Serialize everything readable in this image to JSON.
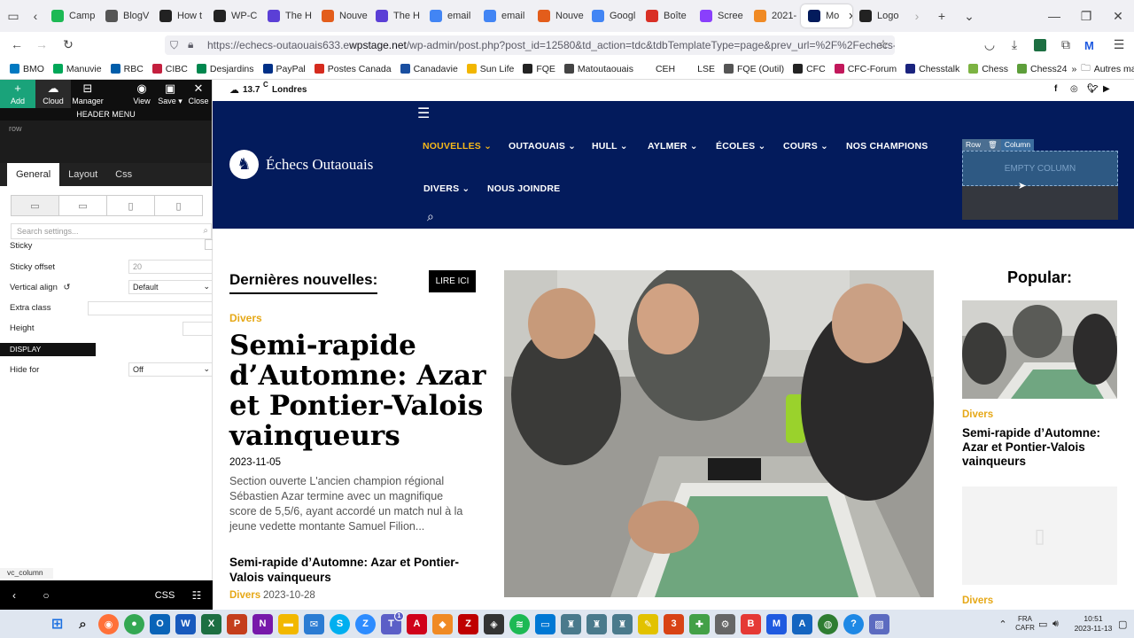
{
  "browser": {
    "tabs": [
      {
        "label": "Camp",
        "color": "#1db954"
      },
      {
        "label": "BlogV",
        "color": "#555"
      },
      {
        "label": "How t",
        "color": "#222"
      },
      {
        "label": "WP-C",
        "color": "#222"
      },
      {
        "label": "The H",
        "color": "#5b3fd6"
      },
      {
        "label": "Nouve",
        "color": "#e35d1b"
      },
      {
        "label": "The H",
        "color": "#5b3fd6"
      },
      {
        "label": "email",
        "color": "#4285f4"
      },
      {
        "label": "email",
        "color": "#4285f4"
      },
      {
        "label": "Nouve",
        "color": "#e35d1b"
      },
      {
        "label": "Googl",
        "color": "#4285f4"
      },
      {
        "label": "Boîte",
        "color": "#d93025"
      },
      {
        "label": "Scree",
        "color": "#8a3ffc"
      },
      {
        "label": "2021-",
        "color": "#f08a24"
      },
      {
        "label": "Mo",
        "color": "#031b5c"
      },
      {
        "label": "Logo",
        "color": "#222"
      }
    ],
    "url_prefix": "https://echecs-outaouais633.e",
    "url_domain": "wpstage.net",
    "url_rest": "/wp-admin/post.php?post_id=12580&td_action=tdc&tdbTemplateType=page&prev_url=%2F%2Fechecs-outaouais",
    "bookmarks": [
      {
        "label": "BMO",
        "color": "#0079c1"
      },
      {
        "label": "Manuvie",
        "color": "#00a758"
      },
      {
        "label": "RBC",
        "color": "#005daa"
      },
      {
        "label": "CIBC",
        "color": "#c41f3e"
      },
      {
        "label": "Desjardins",
        "color": "#00874e"
      },
      {
        "label": "PayPal",
        "color": "#003087"
      },
      {
        "label": "Postes Canada",
        "color": "#d52b1e"
      },
      {
        "label": "Canadavie",
        "color": "#1a4fa0"
      },
      {
        "label": "Sun Life",
        "color": "#f2b600"
      },
      {
        "label": "FQE",
        "color": "#222"
      },
      {
        "label": "Matoutaouais",
        "color": "#444"
      },
      {
        "label": "CEH",
        "color": "#fff"
      },
      {
        "label": "LSE",
        "color": "#fff"
      },
      {
        "label": "FQE (Outil)",
        "color": "#555"
      },
      {
        "label": "CFC",
        "color": "#222"
      },
      {
        "label": "CFC-Forum",
        "color": "#c2185b"
      },
      {
        "label": "Chesstalk",
        "color": "#1a237e"
      },
      {
        "label": "Chess",
        "color": "#7cb342"
      },
      {
        "label": "Chess24",
        "color": "#5d9e3a"
      }
    ],
    "more_bookmarks": "Autres marque-pages"
  },
  "panel": {
    "toolbar": {
      "add": "Add",
      "cloud": "Cloud",
      "manager": "Manager",
      "view": "View",
      "save": "Save",
      "close": "Close"
    },
    "header_title": "HEADER MENU",
    "row_label": "row",
    "tabs": {
      "general": "General",
      "layout": "Layout",
      "css": "Css"
    },
    "search_placeholder": "Search settings...",
    "sticky": "Sticky",
    "sticky_offset": "Sticky offset",
    "sticky_offset_value": "20",
    "vertical_align": "Vertical align",
    "vertical_align_value": "Default",
    "extra_class": "Extra class",
    "height": "Height",
    "display_restrictions": "DISPLAY RESTRICTIONS",
    "hide_for": "Hide for",
    "hide_for_value": "Off",
    "vc_column": "vc_column",
    "css_btn": "CSS"
  },
  "site": {
    "weather_temp": "13.7",
    "weather_unit": "C",
    "weather_city": "Londres",
    "logo_text": "Échecs Outaouais",
    "nav": {
      "nouvelles": "NOUVELLES",
      "outaouais": "OUTAOUAIS",
      "hull": "HULL",
      "aylmer": "AYLMER",
      "ecoles": "ÉCOLES",
      "cours": "COURS",
      "champions": "NOS CHAMPIONS",
      "divers": "DIVERS",
      "joindre": "NOUS JOINDRE"
    },
    "row_tag": "Row",
    "column_tag": "Column",
    "empty_column": "EMPTY COLUMN",
    "section_title": "Dernières nouvelles:",
    "lire_ici": "LIRE ICI",
    "main_category": "Divers",
    "main_title": "Semi-rapide d’Automne: Azar et Pontier-Valois vainqueurs",
    "main_date": "2023-11-05",
    "main_excerpt": "Section ouverte L'ancien champion régional Sébastien Azar termine avec un magnifique score de 5,5/6, ayant accordé un match nul à la jeune vedette montante Samuel Filion...",
    "second_title": "Semi-rapide d’Automne: Azar et Pontier-Valois vainqueurs",
    "second_category": "Divers",
    "second_date": "2023-10-28",
    "popular_title": "Popular:",
    "popular_category": "Divers",
    "popular_item_title": "Semi-rapide d’Automne: Azar et Pontier-Valois vainqueurs",
    "popular_category_2": "Divers"
  },
  "taskbar": {
    "lang": "FRA",
    "layout": "CAFR",
    "time": "10:51",
    "date": "2023-11-13",
    "badge": "1"
  }
}
